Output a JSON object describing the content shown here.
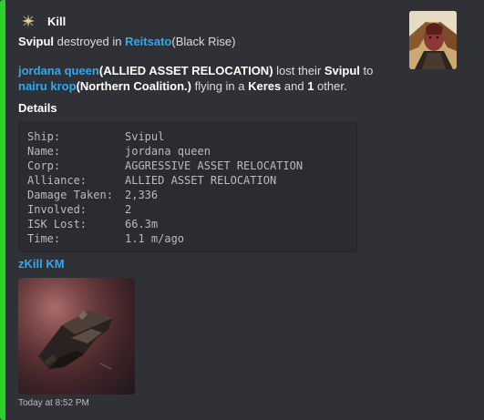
{
  "embed": {
    "accent_color": "#2bd12b",
    "author": {
      "icon": "sparkle-icon",
      "name": "Kill"
    },
    "title": {
      "ship": "Svipul",
      "mid": " destroyed in ",
      "system": "Reitsato",
      "region": "(Black Rise)"
    },
    "description": {
      "victim_name": "jordana queen",
      "victim_corp": "(ALLIED ASSET RELOCATION)",
      "text1": " lost their ",
      "ship": "Svipul",
      "text2": " to",
      "killer_name": "nairu krop",
      "killer_corp": "(Northern Coalition.)",
      "text3": " flying in a ",
      "killer_ship": "Keres",
      "text4": " and ",
      "others": "1",
      "text5": " other."
    },
    "field_title": "Details",
    "details": [
      {
        "key": "Ship:",
        "value": "Svipul"
      },
      {
        "key": "Name:",
        "value": "jordana queen"
      },
      {
        "key": "Corp:",
        "value": "AGGRESSIVE ASSET RELOCATION"
      },
      {
        "key": "Alliance:",
        "value": "ALLIED ASSET RELOCATION"
      },
      {
        "key": "Damage Taken:",
        "value": "2,336"
      },
      {
        "key": "Involved:",
        "value": "2"
      },
      {
        "key": "ISK Lost:",
        "value": "66.3m"
      },
      {
        "key": "Time:",
        "value": "1.1 m/ago"
      }
    ],
    "zkill_link": "zKill KM",
    "footer": "Today at 8:52 PM"
  }
}
